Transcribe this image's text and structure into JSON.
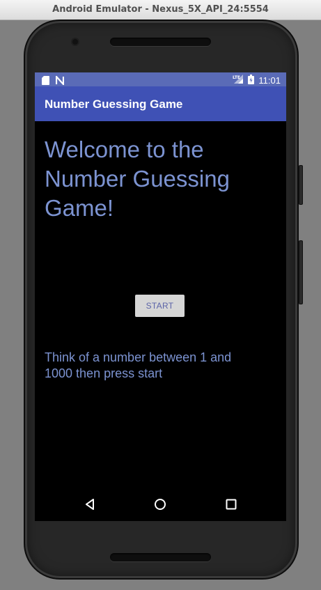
{
  "window": {
    "title": "Android Emulator - Nexus_5X_API_24:5554"
  },
  "status_bar": {
    "time": "11:01",
    "network_label": "LTE",
    "icons": [
      "sd-card-icon",
      "n-notification-icon",
      "lte-signal-icon",
      "battery-icon"
    ]
  },
  "app_bar": {
    "title": "Number Guessing Game"
  },
  "main": {
    "welcome_text": "Welcome to the Number Guessing Game!",
    "start_button": "START",
    "instructions": "Think of a number between 1 and 1000 then press start"
  },
  "nav_bar": {
    "buttons": [
      "back-icon",
      "home-icon",
      "recents-icon"
    ]
  },
  "colors": {
    "status_bar": "#5a6bb7",
    "app_bar": "#3f51b5",
    "text_accent": "#7c93d1",
    "button_bg": "#d6d6d6",
    "screen_bg": "#000000"
  }
}
